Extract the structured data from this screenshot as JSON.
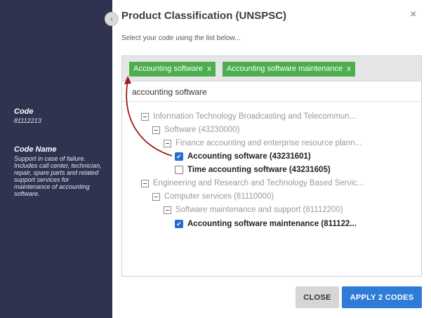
{
  "sidebar": {
    "code_label": "Code",
    "code_value": "81112213",
    "code_name_label": "Code Name",
    "code_name_value": "Support in case of failure. Includes call center, technician, repair, spare parts and related support services for maintenance of accounting software."
  },
  "dialog": {
    "title": "Product Classification (UNSPSC)",
    "close_icon": "×",
    "subtitle": "Select your code using the list below...",
    "collapse_icon": "‹"
  },
  "chips": [
    {
      "label": "Accounting software",
      "remove": "x"
    },
    {
      "label": "Accounting software maintenance",
      "remove": "x"
    }
  ],
  "search": {
    "value": "accounting software"
  },
  "tree": [
    {
      "label": "Information Technology Broadcasting and Telecommun...",
      "type": "group"
    },
    {
      "label": "Software (43230000)",
      "type": "group"
    },
    {
      "label": "Finance accounting and enterprise resource plann...",
      "type": "group"
    },
    {
      "label": "Accounting software (43231601)",
      "type": "leaf",
      "checked": true
    },
    {
      "label": "Time accounting software (43231605)",
      "type": "leaf",
      "checked": false
    },
    {
      "label": "Engineering and Research and Technology Based Servic...",
      "type": "group"
    },
    {
      "label": "Computer services (81110000)",
      "type": "group"
    },
    {
      "label": "Software maintenance and support (81112200)",
      "type": "group"
    },
    {
      "label": "Accounting software maintenance (811122...",
      "type": "leaf",
      "checked": true
    }
  ],
  "buttons": {
    "close": "CLOSE",
    "apply": "APPLY 2 CODES"
  },
  "colors": {
    "sidebar_bg": "#2f3350",
    "chip_green": "#4cae4f",
    "primary_blue": "#2f7bd8",
    "annotation_arrow": "#a01c1c"
  }
}
